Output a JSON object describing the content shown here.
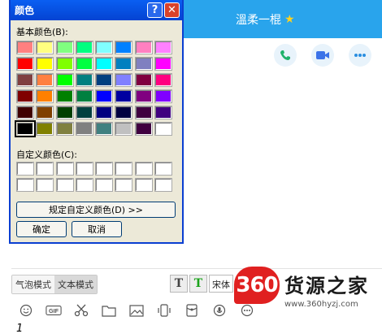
{
  "dialog": {
    "title": "颜色",
    "help_label": "?",
    "close_label": "✕",
    "basic_colors_label": "基本颜色(B):",
    "custom_colors_label": "自定义颜色(C):",
    "define_custom_label": "规定自定义颜色(D) >>",
    "ok_label": "确定",
    "cancel_label": "取消",
    "basic_colors": [
      "#ff8080",
      "#ffff80",
      "#80ff80",
      "#00ff80",
      "#80ffff",
      "#0080ff",
      "#ff80c0",
      "#ff80ff",
      "#ff0000",
      "#ffff00",
      "#80ff00",
      "#00ff40",
      "#00ffff",
      "#0080c0",
      "#8080c0",
      "#ff00ff",
      "#804040",
      "#ff8040",
      "#00ff00",
      "#008080",
      "#004080",
      "#8080ff",
      "#800040",
      "#ff0080",
      "#800000",
      "#ff8000",
      "#008000",
      "#008040",
      "#0000ff",
      "#0000a0",
      "#800080",
      "#8000ff",
      "#400000",
      "#804000",
      "#004000",
      "#004040",
      "#000080",
      "#000040",
      "#400040",
      "#400080",
      "#000000",
      "#808000",
      "#808040",
      "#808080",
      "#408080",
      "#c0c0c0",
      "#400040",
      "#ffffff"
    ],
    "selected_color": "#000000",
    "custom_colors": [
      "#ffffff",
      "#ffffff",
      "#ffffff",
      "#ffffff",
      "#ffffff",
      "#ffffff",
      "#ffffff",
      "#ffffff",
      "#ffffff",
      "#ffffff",
      "#ffffff",
      "#ffffff",
      "#ffffff",
      "#ffffff",
      "#ffffff",
      "#ffffff"
    ]
  },
  "chat": {
    "contact_name": "溫柔一棍",
    "header_color": "#29a4ec",
    "actions": [
      "phone-icon",
      "video-call-icon",
      "more-icon"
    ],
    "mode_tabs": [
      "气泡模式",
      "文本模式"
    ],
    "font_name": "宋体",
    "toolbar_icons": [
      "emoji-icon",
      "gif-icon",
      "scissors-icon",
      "folder-icon",
      "image-icon",
      "shake-icon",
      "red-packet-icon",
      "voice-icon",
      "more-options-icon"
    ],
    "input_text": "1"
  },
  "watermark": {
    "badge": "360",
    "name": "货源之家",
    "url": "www.360hyzj.com"
  }
}
